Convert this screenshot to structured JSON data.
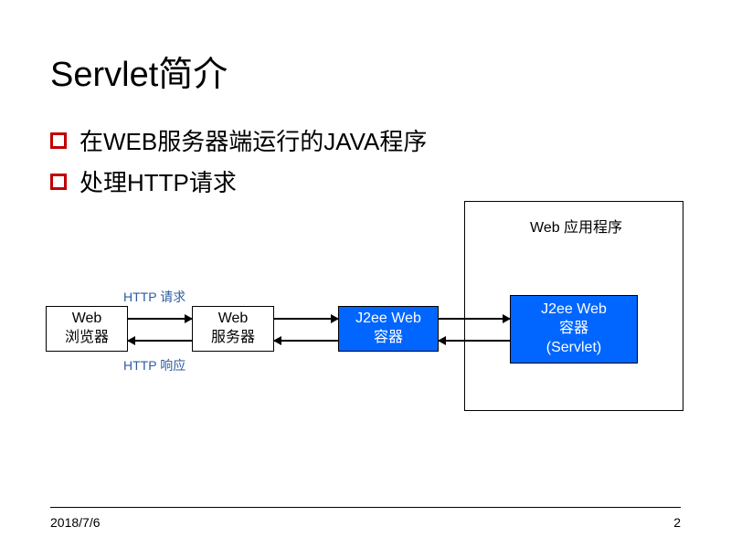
{
  "title": "Servlet简介",
  "bullets": [
    "在WEB服务器端运行的JAVA程序",
    "处理HTTP请求"
  ],
  "diagram": {
    "boxes": {
      "browser": {
        "line1": "Web",
        "line2": "浏览器"
      },
      "server": {
        "line1": "Web",
        "line2": "服务器"
      },
      "container1": {
        "line1": "J2ee Web",
        "line2": "容器"
      },
      "container2": {
        "line1": "J2ee Web",
        "line2": "容器",
        "line3": "(Servlet)"
      }
    },
    "outer_label": "Web 应用程序",
    "labels": {
      "request": "HTTP 请求",
      "response": "HTTP 响应"
    }
  },
  "footer": {
    "date": "2018/7/6",
    "page": "2"
  }
}
